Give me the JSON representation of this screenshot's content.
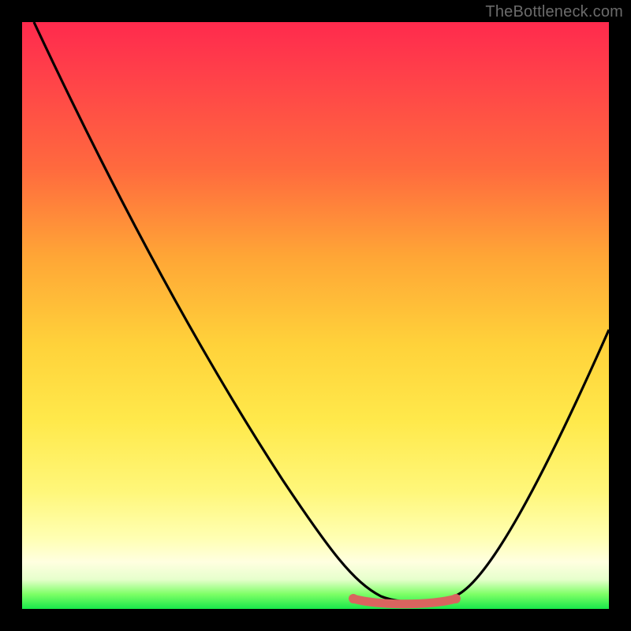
{
  "watermark": "TheBottleneck.com",
  "colors": {
    "frame": "#000000",
    "curve": "#000000",
    "tick_accent": "#d9645f",
    "gradient_top": "#ff2a4d",
    "gradient_mid": "#ffd23a",
    "gradient_bottom": "#18e84a"
  },
  "chart_data": {
    "type": "line",
    "title": "",
    "xlabel": "",
    "ylabel": "",
    "xlim": [
      0,
      1
    ],
    "ylim": [
      0,
      1
    ],
    "series": [
      {
        "name": "bottleneck-curve",
        "x": [
          0.02,
          0.08,
          0.15,
          0.22,
          0.3,
          0.38,
          0.46,
          0.53,
          0.58,
          0.62,
          0.66,
          0.7,
          0.74,
          0.8,
          0.86,
          0.92,
          0.98
        ],
        "y": [
          1.0,
          0.9,
          0.78,
          0.66,
          0.53,
          0.4,
          0.27,
          0.14,
          0.06,
          0.02,
          0.01,
          0.01,
          0.02,
          0.08,
          0.2,
          0.34,
          0.48
        ]
      }
    ],
    "valley_segment": {
      "x0": 0.56,
      "x1": 0.74,
      "y": 0.015
    }
  }
}
